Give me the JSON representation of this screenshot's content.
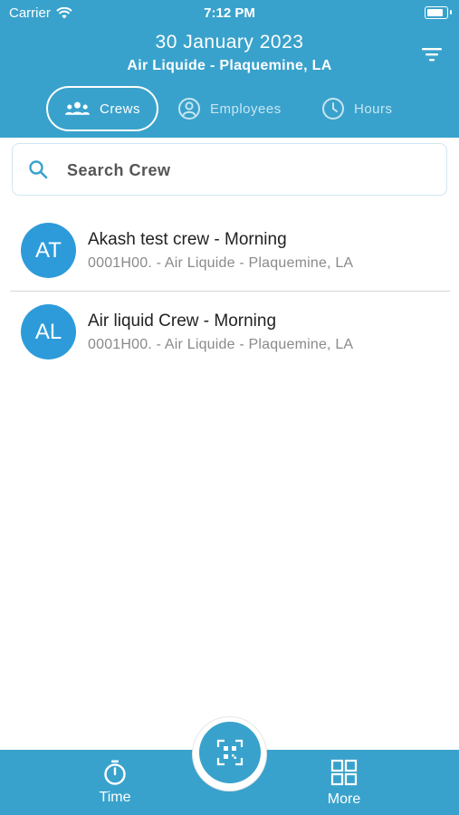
{
  "status_bar": {
    "carrier": "Carrier",
    "time": "7:12 PM",
    "battery_level": 1.0
  },
  "header": {
    "date": "30 January 2023",
    "site": "Air Liquide - Plaquemine, LA",
    "filter_icon": "filter-icon"
  },
  "tabs": [
    {
      "label": "Crews",
      "icon": "group-icon",
      "active": true
    },
    {
      "label": "Employees",
      "icon": "person-circle-icon",
      "active": false
    },
    {
      "label": "Hours",
      "icon": "clock-icon",
      "active": false
    }
  ],
  "search": {
    "placeholder": "Search Crew",
    "value": ""
  },
  "crews": [
    {
      "initials": "AT",
      "name": "Akash test crew - Morning",
      "detail": "0001H00. - Air Liquide - Plaquemine, LA"
    },
    {
      "initials": "AL",
      "name": "Air liquid Crew - Morning",
      "detail": "0001H00. - Air Liquide - Plaquemine, LA"
    }
  ],
  "bottom_nav": {
    "time_label": "Time",
    "more_label": "More",
    "scan_icon": "qr-scan-icon"
  },
  "colors": {
    "accent": "#39a2cc",
    "avatar": "#2d9bda"
  }
}
